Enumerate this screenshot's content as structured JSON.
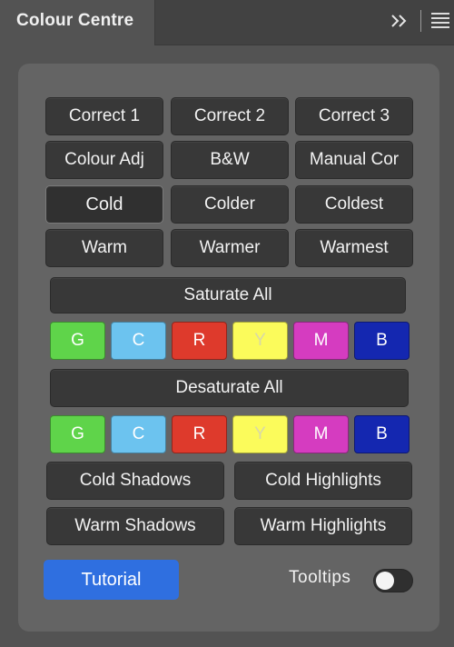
{
  "tab": {
    "title": "Colour Centre"
  },
  "rows": {
    "correct": [
      "Correct 1",
      "Correct 2",
      "Correct 3"
    ],
    "adjust": [
      "Colour Adj",
      "B&W",
      "Manual Cor"
    ],
    "cold": [
      "Cold",
      "Colder",
      "Coldest"
    ],
    "warm": [
      "Warm",
      "Warmer",
      "Warmest"
    ]
  },
  "saturate_all": "Saturate All",
  "desaturate_all": "Desaturate All",
  "swatch_labels": [
    "G",
    "C",
    "R",
    "Y",
    "M",
    "B"
  ],
  "swatch_colors": [
    "#5fd44a",
    "#6cc3ef",
    "#de3a2c",
    "#fbfb5b",
    "#d53cc0",
    "#1427b0"
  ],
  "shadows": {
    "cold_shadows": "Cold Shadows",
    "cold_highlights": "Cold Highlights",
    "warm_shadows": "Warm Shadows",
    "warm_highlights": "Warm Highlights"
  },
  "tutorial": "Tutorial",
  "tooltips": {
    "label": "Tooltips",
    "enabled": false
  },
  "icons": {
    "collapse": "double-chevron-right-icon",
    "menu": "hamburger-menu-icon"
  }
}
